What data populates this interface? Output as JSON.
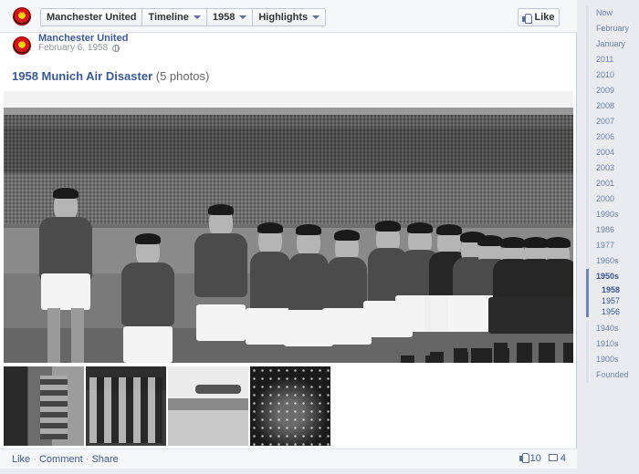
{
  "header": {
    "breadcrumbs": [
      {
        "label": "Manchester United",
        "dropdown": false
      },
      {
        "label": "Timeline",
        "dropdown": true
      },
      {
        "label": "1958",
        "dropdown": true
      },
      {
        "label": "Highlights",
        "dropdown": true
      }
    ],
    "like_button": "Like"
  },
  "post": {
    "author": "Manchester United",
    "date": "February 6, 1958",
    "privacy_icon": "globe-icon",
    "album_name": "1958 Munich Air Disaster",
    "photo_count": "(5 photos)"
  },
  "footer": {
    "actions": [
      "Like",
      "Comment",
      "Share"
    ],
    "likes": "10",
    "comments": "4"
  },
  "scrubber": {
    "items_top": [
      "Now",
      "February",
      "January",
      "2011",
      "2010",
      "2009",
      "2008",
      "2007",
      "2006",
      "2004",
      "2003",
      "2001",
      "2000",
      "1990s",
      "1986",
      "1977",
      "1960s"
    ],
    "active_decade": "1950s",
    "sub_years": [
      "1958",
      "1957",
      "1956"
    ],
    "current_year": "1958",
    "items_bottom": [
      "1940s",
      "1910s",
      "1900s",
      "Founded"
    ]
  },
  "colors": {
    "link": "#3b5998",
    "muted": "#90949c",
    "scrubber": "#6d84b4"
  }
}
